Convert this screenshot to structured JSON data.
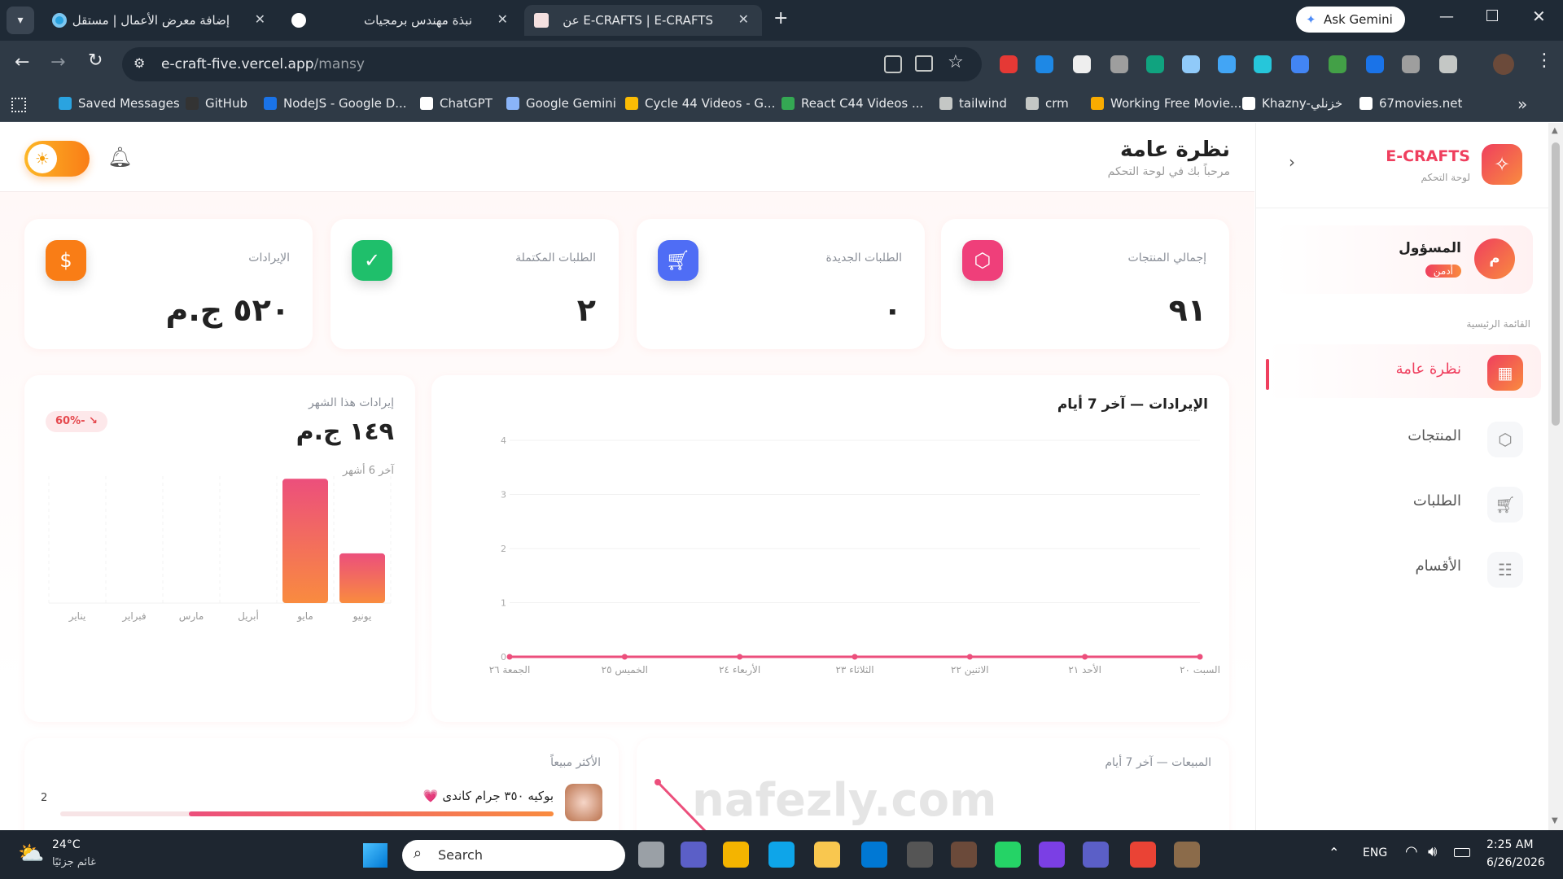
{
  "browser": {
    "tabs": [
      {
        "title": "إضافة معرض الأعمال | مستقل"
      },
      {
        "title": "نبذة مهندس برمجيات"
      },
      {
        "title": "E-CRAFTS | E-CRAFTS عن"
      }
    ],
    "ask_gemini": "Ask Gemini",
    "url_host": "e-craft-five.vercel.app",
    "url_path": "/mansy",
    "bookmarks": [
      "Saved Messages",
      "GitHub",
      "NodeJS - Google D...",
      "ChatGPT",
      "Google Gemini",
      "Cycle 44 Videos - G...",
      "React C44 Videos ...",
      "tailwind",
      "crm",
      "Working Free Movie...",
      "Khazny-خزنلي",
      "67movies.net"
    ],
    "bookmark_colors": [
      "#2aa3e0",
      "#333333",
      "#1a73e8",
      "#ffffff",
      "#8ab4f8",
      "#fbbc04",
      "#34a853",
      "#c4c7c5",
      "#c4c7c5",
      "#f9ab00",
      "#ffffff",
      "#ffffff"
    ]
  },
  "header": {
    "title": "نظرة عامة",
    "subtitle": "مرحباً بك في لوحة التحكم"
  },
  "sidebar": {
    "brand": "E-CRAFTS",
    "brand_sub": "لوحة التحكم",
    "user_name": "المسؤول",
    "user_role": "أدمن",
    "avatar_letter": "م",
    "section_label": "القائمة الرئيسية",
    "items": [
      {
        "label": "نظرة عامة"
      },
      {
        "label": "المنتجات"
      },
      {
        "label": "الطلبات"
      },
      {
        "label": "الأقسام"
      }
    ]
  },
  "stats": [
    {
      "label": "إجمالي المنتجات",
      "value": "٩١",
      "color": "#ef3f7a"
    },
    {
      "label": "الطلبات الجديدة",
      "value": "٠",
      "color": "#4f6df5"
    },
    {
      "label": "الطلبات المكتملة",
      "value": "٢",
      "color": "#1fbf6b"
    },
    {
      "label": "الإيرادات",
      "value": "٥٢٠ ج.م",
      "color": "#f97d16"
    }
  ],
  "monthly": {
    "title": "إيرادات هذا الشهر",
    "value": "١٤٩ ج.م",
    "change": "60%-",
    "sub": "آخر 6 أشهر"
  },
  "chart_data": [
    {
      "type": "line",
      "title": "الإيرادات — آخر 7 أيام",
      "x": [
        "السبت ٢٠",
        "الأحد ٢١",
        "الاثنين ٢٢",
        "الثلاثاء ٢٣",
        "الأربعاء ٢٤",
        "الخميس ٢٥",
        "الجمعة ٢٦"
      ],
      "values": [
        0,
        0,
        0,
        0,
        0,
        0,
        0
      ],
      "ylim": [
        0,
        4
      ],
      "yticks": [
        "0",
        "1",
        "2",
        "3",
        "4"
      ],
      "grid": true
    },
    {
      "type": "bar",
      "categories": [
        "يناير",
        "فبراير",
        "مارس",
        "أبريل",
        "مايو",
        "يونيو"
      ],
      "values": [
        0,
        0,
        0,
        0,
        372,
        149
      ],
      "ylim": [
        0,
        380
      ]
    }
  ],
  "sales": {
    "title": "المبيعات — آخر 7 أيام"
  },
  "top_selling": {
    "title": "الأكثر مبيعاً",
    "items": [
      {
        "name": "بوكيه ٣٥٠ جرام كاندى 💗",
        "count": "2",
        "fraction": 0.74
      }
    ]
  },
  "taskbar": {
    "temp": "24°C",
    "weather": "غائم جزئيًا",
    "search": "Search",
    "lang": "ENG",
    "time": "2:25 AM",
    "date": "6/26/2026"
  },
  "theme": {
    "accent": "#ef3f5e",
    "gradient_end": "#f98b3f"
  }
}
